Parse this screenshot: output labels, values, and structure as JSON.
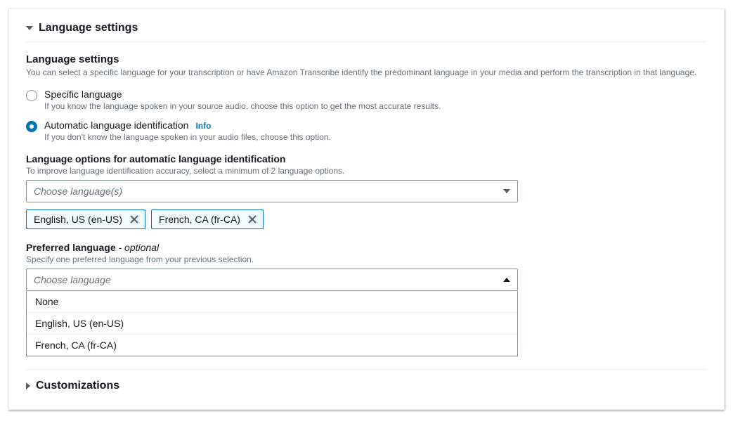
{
  "language_settings": {
    "header": "Language settings",
    "title": "Language settings",
    "description": "You can select a specific language for your transcription or have Amazon Transcribe identify the predominant language in your media and perform the transcription in that language.",
    "radio": {
      "specific": {
        "label": "Specific language",
        "hint": "If you know the language spoken in your source audio, choose this option to get the most accurate results."
      },
      "automatic": {
        "label": "Automatic language identification",
        "info": "Info",
        "hint": "If you don't know the language spoken in your audio files, choose this option."
      }
    },
    "language_options": {
      "label": "Language options for automatic language identification",
      "hint": "To improve language identification accuracy, select a minimum of 2 language options.",
      "placeholder": "Choose language(s)",
      "tokens": [
        "English, US (en-US)",
        "French, CA (fr-CA)"
      ]
    },
    "preferred_language": {
      "label_main": "Preferred language ",
      "label_suffix": "- optional",
      "hint": "Specify one preferred language from your previous selection.",
      "placeholder": "Choose language",
      "options": [
        "None",
        "English, US (en-US)",
        "French, CA (fr-CA)"
      ]
    }
  },
  "customizations": {
    "header": "Customizations"
  }
}
